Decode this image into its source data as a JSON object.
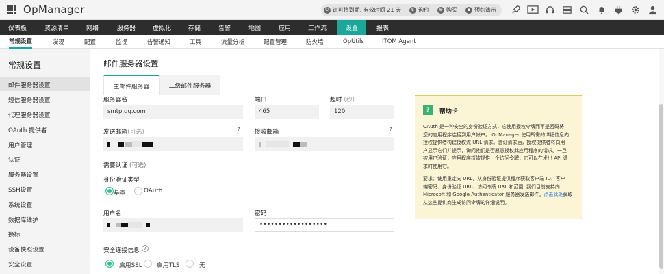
{
  "app": {
    "name": "OpManager"
  },
  "topbar": {
    "license_text": "许可将到期, 有效时间 21 天",
    "quote_label": "询价",
    "buy_label": "购买",
    "demo_label": "预约演示"
  },
  "main_nav": {
    "items": [
      "仪表板",
      "资源清单",
      "网络",
      "服务器",
      "虚拟化",
      "存储",
      "告警",
      "地图",
      "应用",
      "工作流",
      "设置",
      "报表"
    ],
    "active": "设置"
  },
  "sub_nav": {
    "items": [
      "常规设置",
      "发现",
      "配置",
      "监视",
      "告警通知",
      "工具",
      "流量分析",
      "配置管理",
      "防火墙",
      "OpUtils",
      "ITOM Agent"
    ],
    "active": "常规设置"
  },
  "sidebar": {
    "title": "常规设置",
    "items": [
      "邮件服务器设置",
      "短信服务器设置",
      "代理服务器设置",
      "OAuth 提供者",
      "用户管理",
      "认证",
      "服务器设置",
      "SSH设置",
      "系统设置",
      "数据库维护",
      "换标",
      "设备快照设置",
      "安全设置"
    ],
    "active": "邮件服务器设置"
  },
  "page": {
    "title": "邮件服务器设置",
    "tabs": [
      "主邮件服务器",
      "二级邮件服务器"
    ],
    "active_tab": "主邮件服务器"
  },
  "form": {
    "server_name_label": "服务器名",
    "server_name_value": "smtp.qq.com",
    "port_label": "端口",
    "port_value": "465",
    "timeout_label": "超时",
    "timeout_unit": "(秒)",
    "timeout_value": "120",
    "from_label": "发送邮箱",
    "from_optional": "(可选)",
    "to_label": "接收邮箱",
    "auth_label": "需要认证",
    "auth_optional": "(可选)",
    "auth_type_label": "身份验证类型",
    "auth_basic": "基本",
    "auth_oauth": "OAuth",
    "auth_selected": "基本",
    "username_label": "用户名",
    "password_label": "密码",
    "password_value": "••••••••••••••••••",
    "secure_label": "安全连接信息",
    "ssl_label": "启用SSL",
    "tls_label": "启用TLS",
    "none_label": "无",
    "secure_selected": "启用SSL",
    "help_q": "?"
  },
  "help_card": {
    "badge": "?",
    "title": "帮助卡",
    "para1_lines": [
      "OAuth 是一种安全的身份验证方式，它使用授权令牌而不是密码将",
      "您的应用程序连接到用户帐户。 OpManager 使用所需的详细信息向",
      "授权提供者构建授权流 URL 请求。验证请求后，授权提供者将向用",
      "户显示它们并提示，询问他们是否愿意授权此应用程序的请求。一旦",
      "被用户验证，应用程序将被提供一个访问令牌，它可以在发出 API 请",
      "求时使用它。"
    ],
    "para2_lines": [
      "要求：使用重定向 URL，从身份验证提供程序获取客户端 ID、客户",
      "端密码、身份验证 URL、访问令牌 URL 和范围 .我们目前支持向",
      "Microsoft 和 Google Authenticator 服务器发送邮件。"
    ],
    "link_text": "点击此处",
    "para2_tail": "获取",
    "para2_last": "从这些提供商生成访问令牌的详细说明。"
  }
}
